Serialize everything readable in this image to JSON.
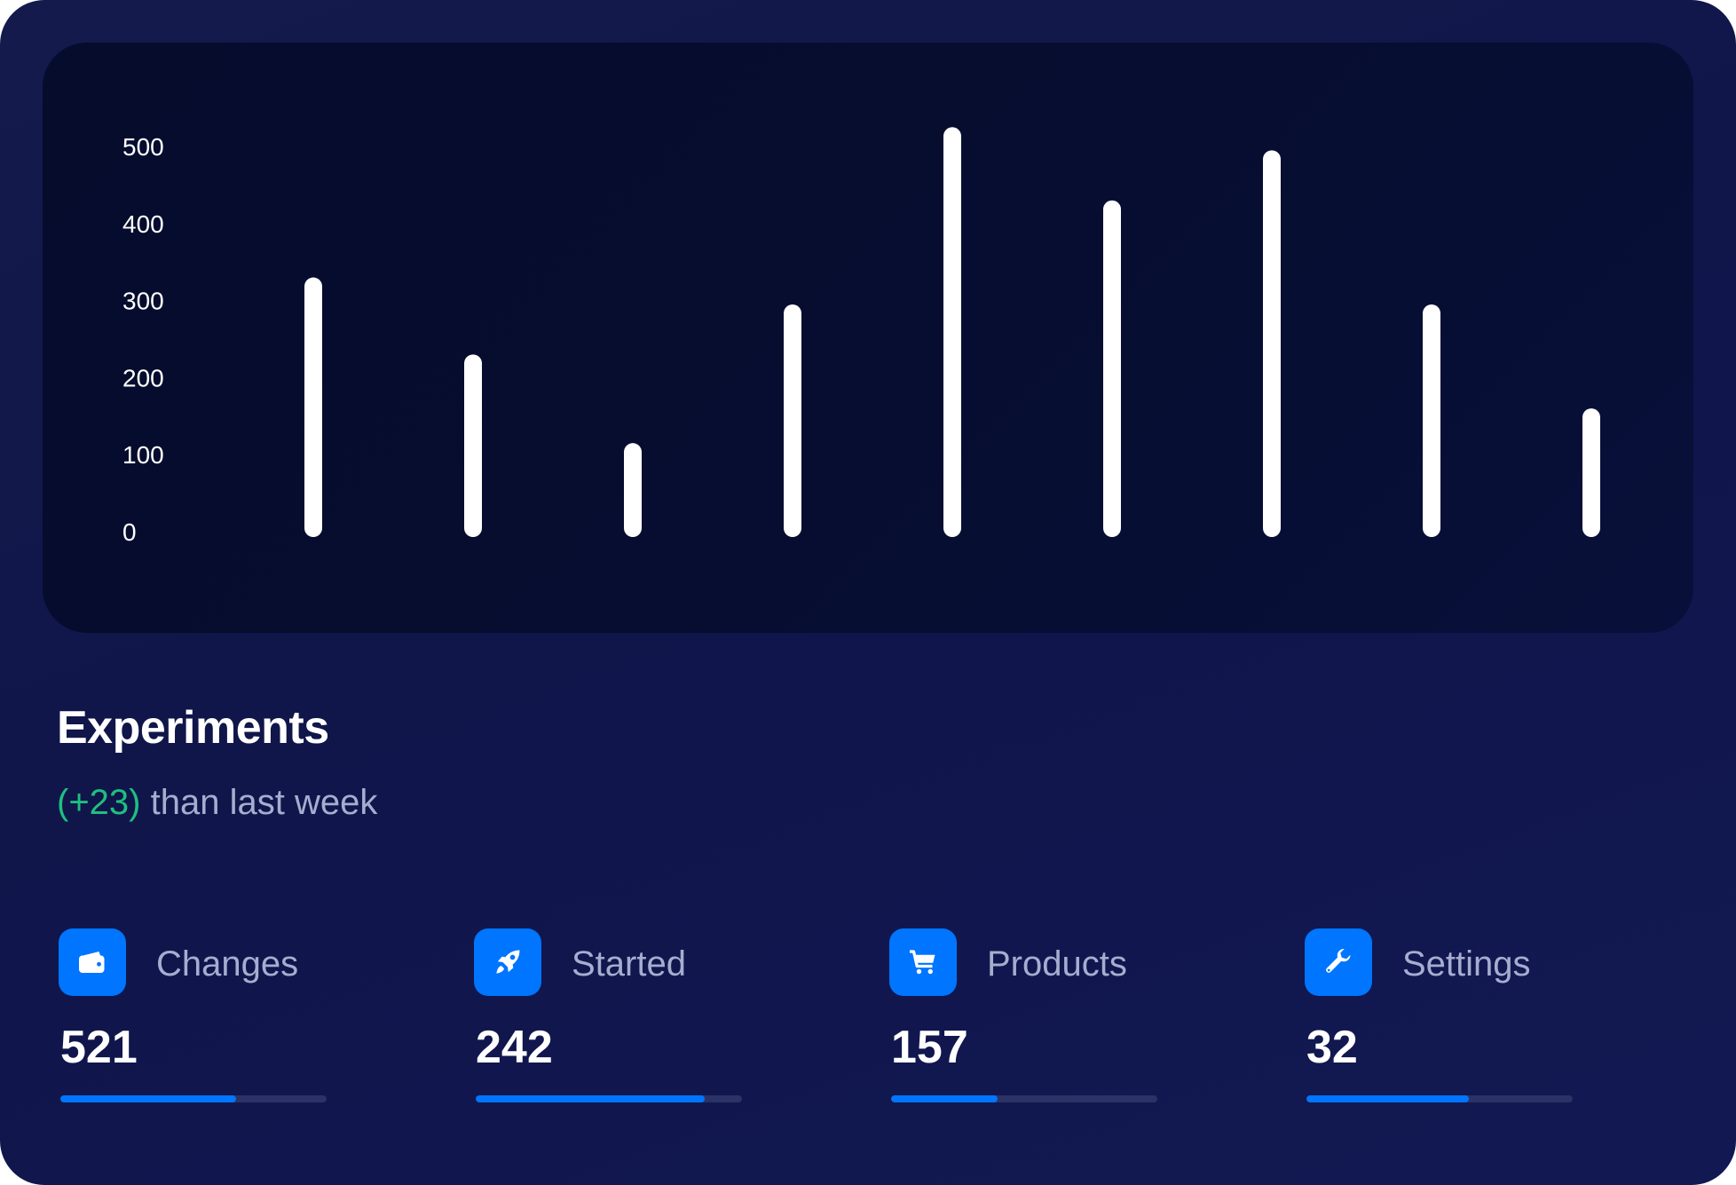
{
  "chart_data": {
    "type": "bar",
    "title": "",
    "xlabel": "",
    "ylabel": "",
    "ylim": [
      0,
      500
    ],
    "yticks": [
      0,
      100,
      200,
      300,
      400,
      500
    ],
    "grid": false,
    "categories": [
      "",
      "",
      "",
      "",
      "",
      "",
      "",
      "",
      ""
    ],
    "values": [
      330,
      230,
      115,
      295,
      525,
      430,
      495,
      295,
      160
    ],
    "bar_color": "#ffffff"
  },
  "header": {
    "title": "Experiments",
    "delta": "(+23)",
    "subtitle_rest": " than last week"
  },
  "stats": [
    {
      "label": "Changes",
      "value": "521",
      "icon": "wallet-icon",
      "progress": 0.66
    },
    {
      "label": "Started",
      "value": "242",
      "icon": "rocket-icon",
      "progress": 0.86
    },
    {
      "label": "Products",
      "value": "157",
      "icon": "cart-icon",
      "progress": 0.4
    },
    {
      "label": "Settings",
      "value": "32",
      "icon": "wrench-icon",
      "progress": 0.61
    }
  ],
  "colors": {
    "accent": "#0075ff",
    "positive": "#1fbf7f",
    "muted_text": "#a6adcf"
  }
}
